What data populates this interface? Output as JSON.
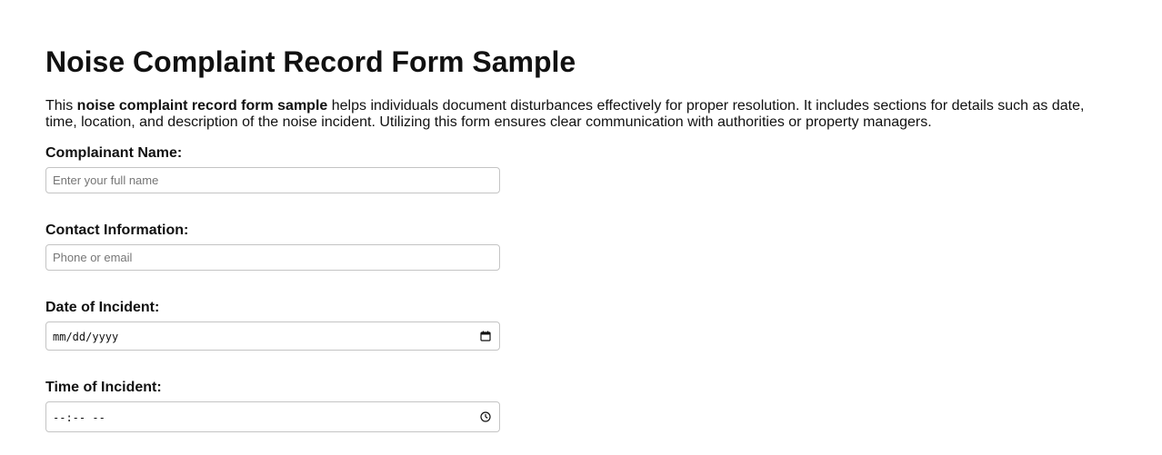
{
  "page": {
    "title": "Noise Complaint Record Form Sample",
    "intro": {
      "prefix": "This ",
      "bold": "noise complaint record form sample",
      "suffix": " helps individuals document disturbances effectively for proper resolution. It includes sections for details such as date, time, location, and description of the noise incident. Utilizing this form ensures clear communication with authorities or property managers."
    }
  },
  "form": {
    "complainant_name": {
      "label": "Complainant Name:",
      "placeholder": "Enter your full name",
      "value": ""
    },
    "contact_information": {
      "label": "Contact Information:",
      "placeholder": "Phone or email",
      "value": ""
    },
    "date_of_incident": {
      "label": "Date of Incident:",
      "placeholder": "mm/dd/yyyy",
      "icon": "calendar-icon"
    },
    "time_of_incident": {
      "label": "Time of Incident:",
      "placeholder": "--:-- --",
      "icon": "clock-icon"
    }
  }
}
